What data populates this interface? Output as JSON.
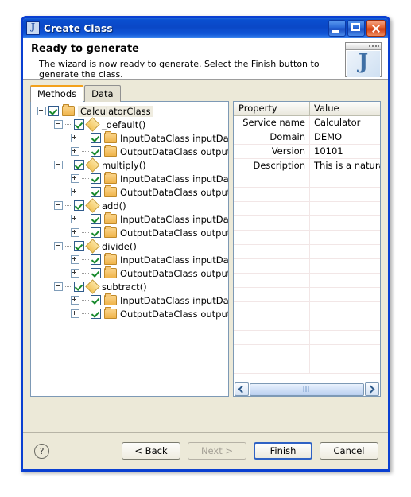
{
  "window": {
    "title": "Create Class",
    "icon": "java-class-icon",
    "controls": {
      "minimize": "minimize-button",
      "maximize": "maximize-button",
      "close": "close-button"
    }
  },
  "banner": {
    "heading": "Ready to generate",
    "description": "The wizard is now ready to generate. Select the Finish button to generate the class.",
    "icon_letter": "J"
  },
  "tabs": [
    {
      "label": "Methods",
      "active": true
    },
    {
      "label": "Data",
      "active": false
    }
  ],
  "tree": [
    {
      "indent": 0,
      "toggle": "minus",
      "dots": false,
      "icon": "folder",
      "label": "CalculatorClass",
      "selected": true,
      "checked": true
    },
    {
      "indent": 1,
      "toggle": "minus",
      "dots": true,
      "icon": "diamond",
      "label": "_default()",
      "selected": false,
      "checked": true
    },
    {
      "indent": 2,
      "toggle": "plus",
      "dots": true,
      "icon": "folder",
      "label": "InputDataClass  inputData",
      "selected": false,
      "checked": true
    },
    {
      "indent": 2,
      "toggle": "plus",
      "dots": true,
      "icon": "folder",
      "label": "OutputDataClass  outputData",
      "selected": false,
      "checked": true
    },
    {
      "indent": 1,
      "toggle": "minus",
      "dots": true,
      "icon": "diamond",
      "label": "multiply()",
      "selected": false,
      "checked": true
    },
    {
      "indent": 2,
      "toggle": "plus",
      "dots": true,
      "icon": "folder",
      "label": "InputDataClass  inputData",
      "selected": false,
      "checked": true
    },
    {
      "indent": 2,
      "toggle": "plus",
      "dots": true,
      "icon": "folder",
      "label": "OutputDataClass  outputData",
      "selected": false,
      "checked": true
    },
    {
      "indent": 1,
      "toggle": "minus",
      "dots": true,
      "icon": "diamond",
      "label": "add()",
      "selected": false,
      "checked": true
    },
    {
      "indent": 2,
      "toggle": "plus",
      "dots": true,
      "icon": "folder",
      "label": "InputDataClass  inputData",
      "selected": false,
      "checked": true
    },
    {
      "indent": 2,
      "toggle": "plus",
      "dots": true,
      "icon": "folder",
      "label": "OutputDataClass  outputData",
      "selected": false,
      "checked": true
    },
    {
      "indent": 1,
      "toggle": "minus",
      "dots": true,
      "icon": "diamond",
      "label": "divide()",
      "selected": false,
      "checked": true
    },
    {
      "indent": 2,
      "toggle": "plus",
      "dots": true,
      "icon": "folder",
      "label": "InputDataClass  inputData",
      "selected": false,
      "checked": true
    },
    {
      "indent": 2,
      "toggle": "plus",
      "dots": true,
      "icon": "folder",
      "label": "OutputDataClass  outputData",
      "selected": false,
      "checked": true
    },
    {
      "indent": 1,
      "toggle": "minus",
      "dots": true,
      "icon": "diamond",
      "label": "subtract()",
      "selected": false,
      "checked": true
    },
    {
      "indent": 2,
      "toggle": "plus",
      "dots": true,
      "icon": "folder",
      "label": "InputDataClass  inputData",
      "selected": false,
      "checked": true
    },
    {
      "indent": 2,
      "toggle": "plus",
      "dots": true,
      "icon": "folder",
      "label": "OutputDataClass  outputData",
      "selected": false,
      "checked": true
    }
  ],
  "table": {
    "columns": [
      "Property",
      "Value"
    ],
    "rows": [
      {
        "property": "Service name",
        "value": "Calculator"
      },
      {
        "property": "Domain",
        "value": "DEMO"
      },
      {
        "property": "Version",
        "value": "10101"
      },
      {
        "property": "Description",
        "value": "This is a natural :"
      }
    ],
    "empty_rows": 14,
    "scrollbar": {
      "left": "scroll-left-arrow",
      "right": "scroll-right-arrow"
    }
  },
  "footer": {
    "help": "?",
    "buttons": [
      {
        "label": "< Back",
        "state": "enabled"
      },
      {
        "label": "Next >",
        "state": "disabled"
      },
      {
        "label": "Finish",
        "state": "default"
      },
      {
        "label": "Cancel",
        "state": "enabled"
      }
    ]
  },
  "colors": {
    "title_blue": "#0a47c6",
    "dialog_bg": "#ece9d8",
    "tab_accent": "#f3a11b",
    "close_red": "#cf3d14",
    "check_green": "#17892c"
  }
}
